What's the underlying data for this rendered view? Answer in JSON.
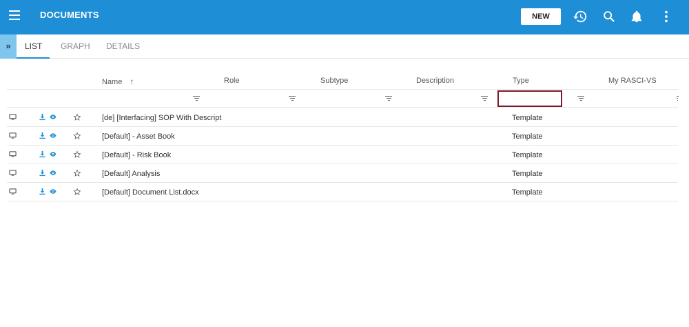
{
  "app": {
    "title": "DOCUMENTS",
    "new_label": "NEW"
  },
  "appbar_icons": [
    "history-icon",
    "search-icon",
    "bell-icon",
    "more-vert-icon"
  ],
  "collapse_glyph": "»",
  "tabs": [
    {
      "label": "LIST",
      "active": true
    },
    {
      "label": "GRAPH",
      "active": false
    },
    {
      "label": "DETAILS",
      "active": false
    }
  ],
  "columns": {
    "name": "Name",
    "role": "Role",
    "subtype": "Subtype",
    "description": "Description",
    "type": "Type",
    "rasci": "My RASCI-VS"
  },
  "sort_glyph": "↑",
  "rows": [
    {
      "name": "[de] [Interfacing] SOP With Descript",
      "type": "Template"
    },
    {
      "name": "[Default] - Asset Book",
      "type": "Template"
    },
    {
      "name": "[Default] - Risk Book",
      "type": "Template"
    },
    {
      "name": "[Default] Analysis",
      "type": "Template"
    },
    {
      "name": "[Default] Document List.docx",
      "type": "Template"
    }
  ],
  "colors": {
    "appbar": "#1e8fd6",
    "accent": "#1e8fd6",
    "focus_border": "#7b1a2a"
  }
}
